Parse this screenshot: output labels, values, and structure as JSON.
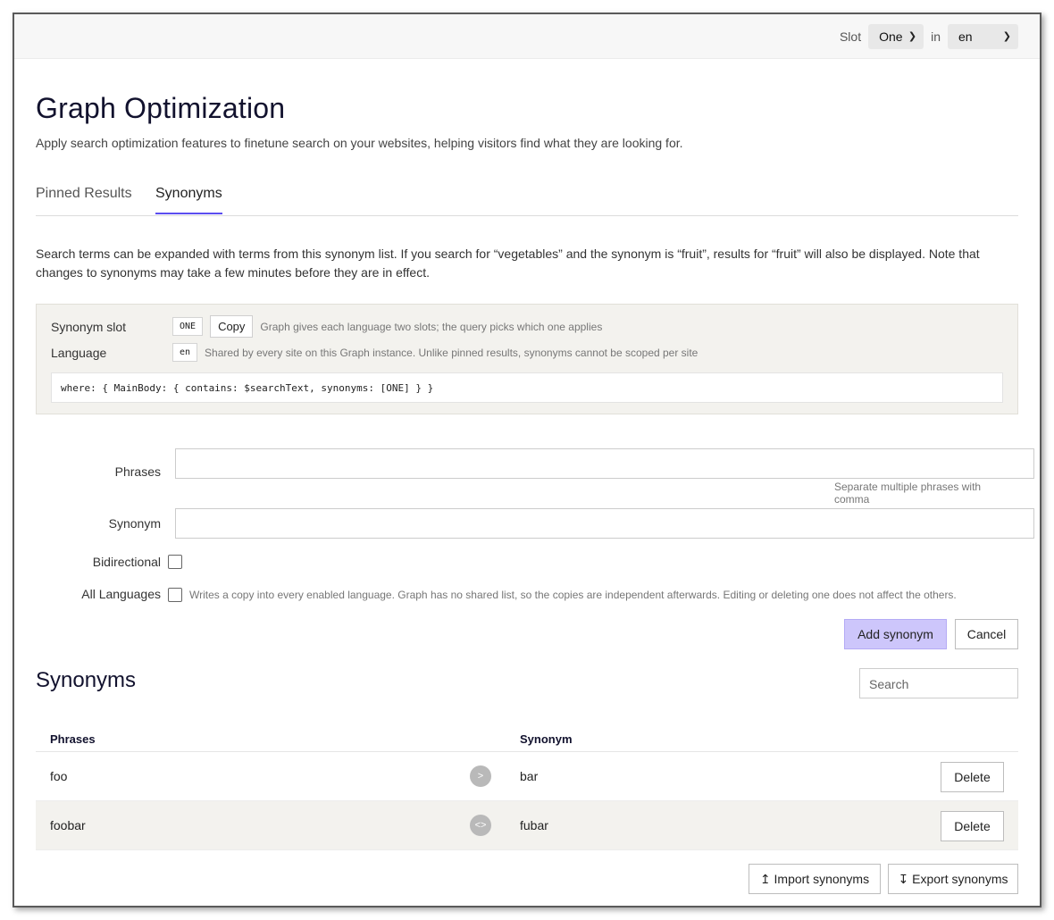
{
  "topbar": {
    "slot_label": "Slot",
    "slot_value": "One",
    "in_label": "in",
    "lang_value": "en"
  },
  "page": {
    "title": "Graph Optimization",
    "subtitle": "Apply search optimization features to finetune search on your websites, helping visitors find what they are looking for."
  },
  "tabs": [
    {
      "label": "Pinned Results",
      "active": false
    },
    {
      "label": "Synonyms",
      "active": true
    }
  ],
  "description": "Search terms can be expanded with terms from this synonym list. If you search for “vegetables” and the synonym is “fruit”, results for “fruit” will also be displayed. Note that changes to synonyms may take a few minutes before they are in effect.",
  "slot_box": {
    "slot_label": "Synonym slot",
    "slot_chip": "ONE",
    "copy_label": "Copy",
    "slot_hint": "Graph gives each language two slots; the query picks which one applies",
    "lang_label": "Language",
    "lang_chip": "en",
    "lang_hint": "Shared by every site on this Graph instance. Unlike pinned results, synonyms cannot be scoped per site",
    "code": "where: { MainBody: { contains: $searchText, synonyms: [ONE] } }"
  },
  "form": {
    "phrases_label": "Phrases",
    "phrases_value": "",
    "phrases_hint": "Separate multiple phrases with comma",
    "synonym_label": "Synonym",
    "synonym_value": "",
    "bidirectional_label": "Bidirectional",
    "all_languages_label": "All Languages",
    "all_languages_hint": "Writes a copy into every enabled language. Graph has no shared list, so the copies are independent afterwards. Editing or deleting one does not affect the others.",
    "add_label": "Add synonym",
    "cancel_label": "Cancel"
  },
  "list": {
    "title": "Synonyms",
    "search_placeholder": "Search",
    "col_phrases": "Phrases",
    "col_synonym": "Synonym",
    "rows": [
      {
        "phrases": "foo",
        "direction": ">",
        "synonym": "bar",
        "delete_label": "Delete"
      },
      {
        "phrases": "foobar",
        "direction": "<>",
        "synonym": "fubar",
        "delete_label": "Delete"
      }
    ],
    "import_label": "↥ Import synonyms",
    "export_label": "↧ Export synonyms"
  },
  "colors": {
    "accent": "#5b4df0",
    "primary_button": "#cdc6fb",
    "panel": "#f3f2ee",
    "heading": "#12122e"
  }
}
